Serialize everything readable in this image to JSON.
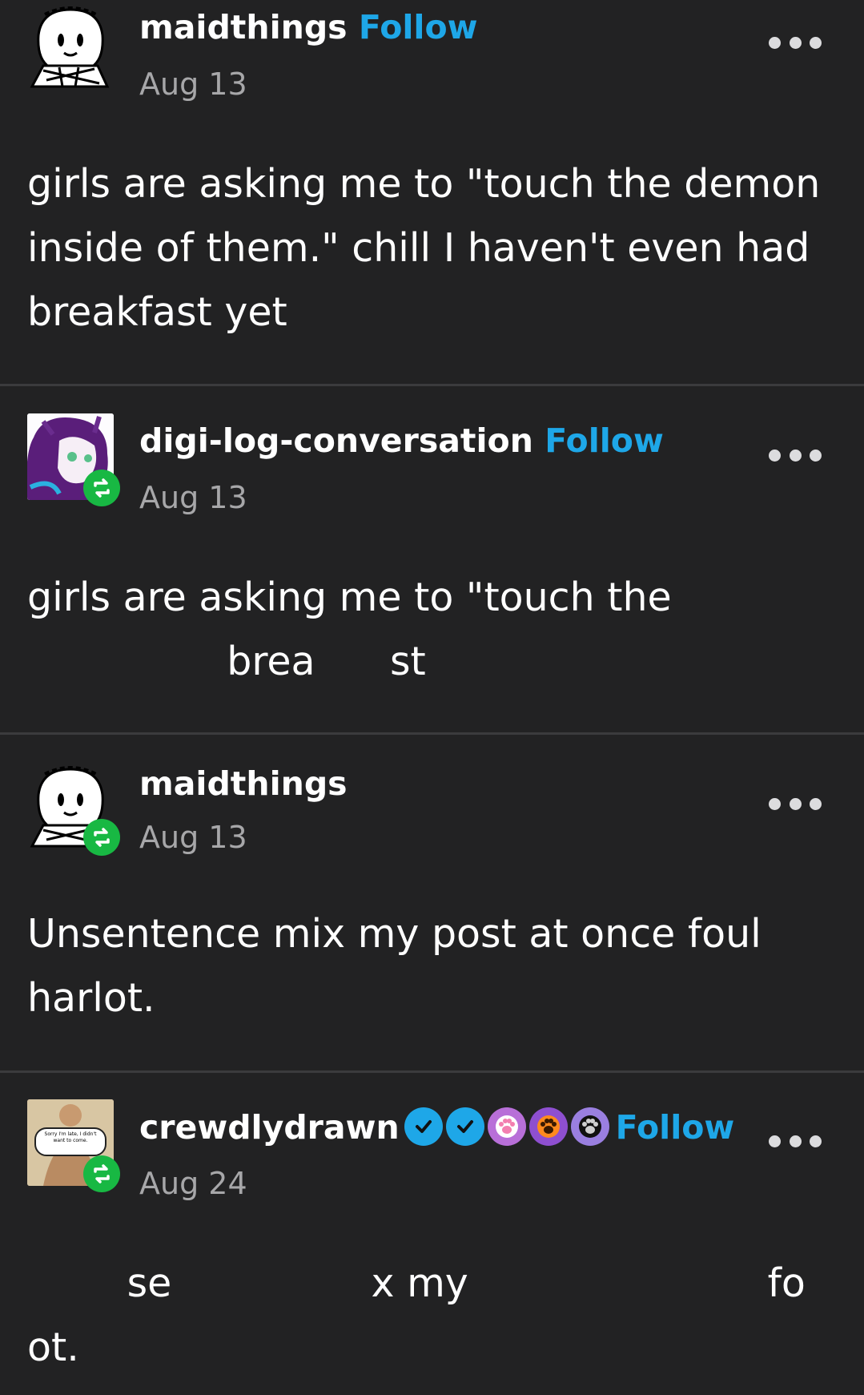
{
  "posts": [
    {
      "username": "maidthings",
      "follow_label": "Follow",
      "date": "Aug 13",
      "text": "girls are asking me to \"touch the demon\ninside of them.\" chill I haven't even had\nbreakfast yet"
    },
    {
      "username": "digi-log-conversation",
      "follow_label": "Follow",
      "date": "Aug 13",
      "text": "girls are asking me to \"touch the\n                brea      st"
    },
    {
      "username": "maidthings",
      "date": "Aug 13",
      "text": "Unsentence mix my post at once foul\nharlot."
    },
    {
      "username": "crewdlydrawn",
      "follow_label": "Follow",
      "date": "Aug 24",
      "avatar_caption": "Sorry I'm late, I didn't want to come.",
      "text": "        se                x my                        fo\not."
    }
  ],
  "colors": {
    "background": "#222223",
    "follow": "#1ea7e8",
    "reblog_badge": "#18b843",
    "date": "#a7a7a9"
  },
  "icons": {
    "more": "more-options-icon",
    "reblog": "reblog-icon",
    "verified": "verified-badge-icon",
    "paw": "paw-badge-icon"
  }
}
